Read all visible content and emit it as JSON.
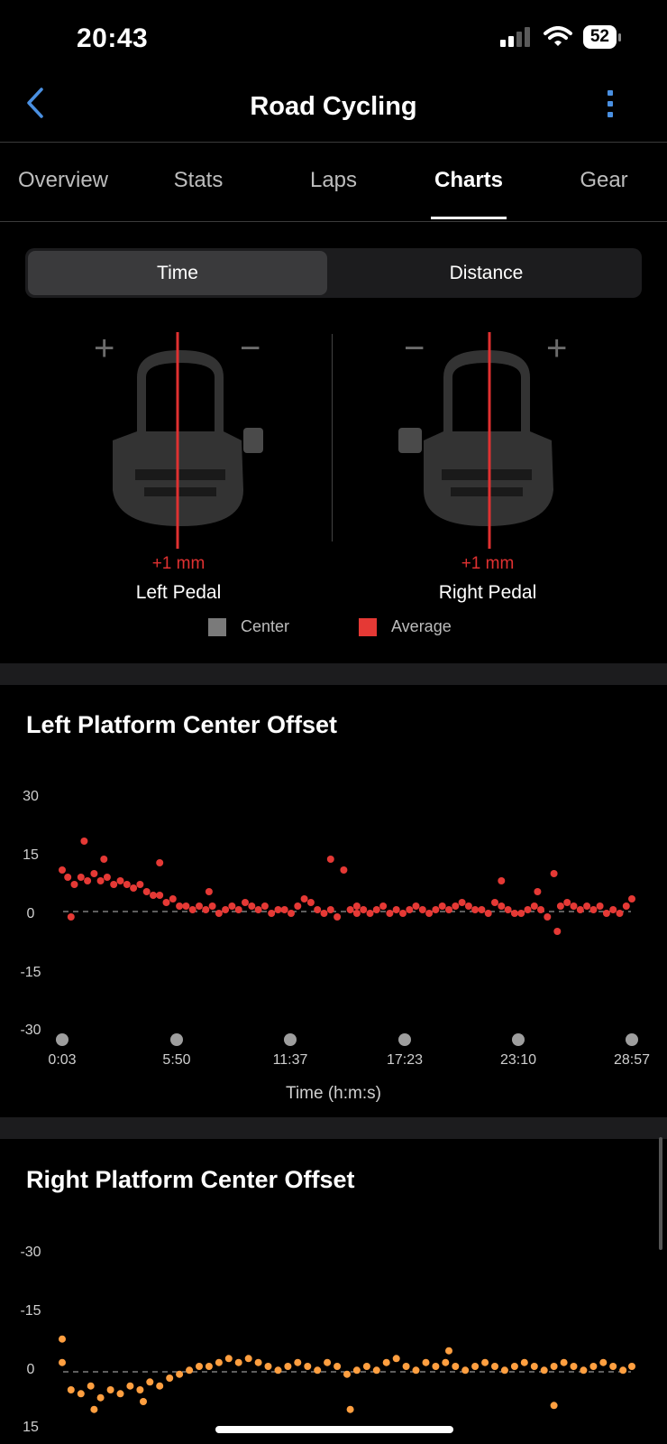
{
  "status": {
    "time": "20:43",
    "battery": "52",
    "icons": [
      "cellular-signal-icon",
      "wifi-icon",
      "battery-icon"
    ]
  },
  "nav": {
    "back_icon": "chevron-left-icon",
    "title": "Road Cycling",
    "more_icon": "vertical-ellipsis-icon"
  },
  "tabs": [
    {
      "label": "Overview",
      "active": false
    },
    {
      "label": "Stats",
      "active": false
    },
    {
      "label": "Laps",
      "active": false
    },
    {
      "label": "Charts",
      "active": true
    },
    {
      "label": "Gear",
      "active": false
    }
  ],
  "segment": {
    "options": [
      "Time",
      "Distance"
    ],
    "selected": "Time"
  },
  "pedals": {
    "left": {
      "offset": "+1 mm",
      "label": "Left Pedal",
      "plus": "+",
      "minus": "−"
    },
    "right": {
      "offset": "+1 mm",
      "label": "Right Pedal",
      "plus": "+",
      "minus": "−"
    }
  },
  "legend": [
    {
      "label": "Center",
      "color": "#7a7a7a"
    },
    {
      "label": "Average",
      "color": "#e53935"
    }
  ],
  "colors": {
    "accent": "#4a90e2",
    "left_series": "#e53935",
    "right_series": "#ff9f40",
    "average_line": "#e03131"
  },
  "chart_data": [
    {
      "type": "scatter",
      "title": "Left Platform Center Offset",
      "xlabel": "Time (h:m:s)",
      "ylabel": "",
      "y_ticks": [
        "30",
        "15",
        "0",
        "-15",
        "-30"
      ],
      "ylim": [
        -30,
        30
      ],
      "x_ticks": [
        "0:03",
        "5:50",
        "11:37",
        "17:23",
        "23:10",
        "28:57"
      ],
      "x_range_seconds": [
        3,
        1737
      ],
      "series": [
        {
          "color": "#e53935",
          "points": [
            [
              3,
              10
            ],
            [
              20,
              8
            ],
            [
              40,
              6
            ],
            [
              60,
              8
            ],
            [
              80,
              7
            ],
            [
              100,
              9
            ],
            [
              120,
              7
            ],
            [
              140,
              8
            ],
            [
              160,
              6
            ],
            [
              180,
              7
            ],
            [
              200,
              6
            ],
            [
              220,
              5
            ],
            [
              240,
              6
            ],
            [
              260,
              4
            ],
            [
              280,
              3
            ],
            [
              300,
              3
            ],
            [
              320,
              1
            ],
            [
              340,
              2
            ],
            [
              360,
              0
            ],
            [
              380,
              0
            ],
            [
              400,
              -1
            ],
            [
              420,
              0
            ],
            [
              440,
              -1
            ],
            [
              460,
              0
            ],
            [
              480,
              -2
            ],
            [
              500,
              -1
            ],
            [
              520,
              0
            ],
            [
              540,
              -1
            ],
            [
              560,
              1
            ],
            [
              580,
              0
            ],
            [
              600,
              -1
            ],
            [
              620,
              0
            ],
            [
              640,
              -2
            ],
            [
              660,
              -1
            ],
            [
              680,
              -1
            ],
            [
              700,
              -2
            ],
            [
              720,
              0
            ],
            [
              740,
              2
            ],
            [
              760,
              1
            ],
            [
              780,
              -1
            ],
            [
              800,
              -2
            ],
            [
              820,
              -1
            ],
            [
              840,
              -3
            ],
            [
              860,
              10
            ],
            [
              880,
              -1
            ],
            [
              900,
              0
            ],
            [
              920,
              -1
            ],
            [
              940,
              -2
            ],
            [
              960,
              -1
            ],
            [
              980,
              0
            ],
            [
              1000,
              -2
            ],
            [
              1020,
              -1
            ],
            [
              1040,
              -2
            ],
            [
              1060,
              -1
            ],
            [
              1080,
              0
            ],
            [
              1100,
              -1
            ],
            [
              1120,
              -2
            ],
            [
              1140,
              -1
            ],
            [
              1160,
              0
            ],
            [
              1180,
              -1
            ],
            [
              1200,
              0
            ],
            [
              1220,
              1
            ],
            [
              1240,
              0
            ],
            [
              1260,
              -1
            ],
            [
              1280,
              -1
            ],
            [
              1300,
              -2
            ],
            [
              1320,
              1
            ],
            [
              1340,
              0
            ],
            [
              1360,
              -1
            ],
            [
              1380,
              -2
            ],
            [
              1400,
              -2
            ],
            [
              1420,
              -1
            ],
            [
              1440,
              0
            ],
            [
              1460,
              -1
            ],
            [
              1480,
              -3
            ],
            [
              1500,
              9
            ],
            [
              1520,
              0
            ],
            [
              1540,
              1
            ],
            [
              1560,
              0
            ],
            [
              1580,
              -1
            ],
            [
              1600,
              0
            ],
            [
              1620,
              -1
            ],
            [
              1640,
              0
            ],
            [
              1660,
              -2
            ],
            [
              1680,
              -1
            ],
            [
              1700,
              -2
            ],
            [
              1720,
              0
            ],
            [
              1737,
              2
            ],
            [
              70,
              18
            ],
            [
              130,
              13
            ],
            [
              300,
              12
            ],
            [
              450,
              4
            ],
            [
              820,
              13
            ],
            [
              900,
              -2
            ],
            [
              1340,
              7
            ],
            [
              1450,
              4
            ],
            [
              1510,
              -7
            ],
            [
              30,
              -3
            ]
          ]
        }
      ]
    },
    {
      "type": "scatter",
      "title": "Right Platform Center Offset",
      "xlabel": "",
      "ylabel": "",
      "y_ticks": [
        "-30",
        "-15",
        "0",
        "15"
      ],
      "ylim": [
        -30,
        15
      ],
      "series": [
        {
          "color": "#ff9f40",
          "points": [
            [
              3,
              -1
            ],
            [
              30,
              6
            ],
            [
              60,
              7
            ],
            [
              90,
              5
            ],
            [
              120,
              8
            ],
            [
              150,
              6
            ],
            [
              180,
              7
            ],
            [
              210,
              5
            ],
            [
              240,
              6
            ],
            [
              270,
              4
            ],
            [
              300,
              5
            ],
            [
              330,
              3
            ],
            [
              360,
              2
            ],
            [
              390,
              1
            ],
            [
              420,
              0
            ],
            [
              450,
              0
            ],
            [
              480,
              -1
            ],
            [
              510,
              -2
            ],
            [
              540,
              -1
            ],
            [
              570,
              -2
            ],
            [
              600,
              -1
            ],
            [
              630,
              0
            ],
            [
              660,
              1
            ],
            [
              690,
              0
            ],
            [
              720,
              -1
            ],
            [
              750,
              0
            ],
            [
              780,
              1
            ],
            [
              810,
              -1
            ],
            [
              840,
              0
            ],
            [
              870,
              2
            ],
            [
              900,
              1
            ],
            [
              930,
              0
            ],
            [
              960,
              1
            ],
            [
              990,
              -1
            ],
            [
              1020,
              -2
            ],
            [
              1050,
              0
            ],
            [
              1080,
              1
            ],
            [
              1110,
              -1
            ],
            [
              1140,
              0
            ],
            [
              1170,
              -1
            ],
            [
              1200,
              0
            ],
            [
              1230,
              1
            ],
            [
              1260,
              0
            ],
            [
              1290,
              -1
            ],
            [
              1320,
              0
            ],
            [
              1350,
              1
            ],
            [
              1380,
              0
            ],
            [
              1410,
              -1
            ],
            [
              1440,
              0
            ],
            [
              1470,
              1
            ],
            [
              1500,
              0
            ],
            [
              1530,
              -1
            ],
            [
              1560,
              0
            ],
            [
              1590,
              1
            ],
            [
              1620,
              0
            ],
            [
              1650,
              -1
            ],
            [
              1680,
              0
            ],
            [
              1710,
              1
            ],
            [
              1737,
              0
            ],
            [
              3,
              -7
            ],
            [
              100,
              11
            ],
            [
              250,
              9
            ],
            [
              880,
              11
            ],
            [
              1500,
              10
            ],
            [
              1180,
              -4
            ]
          ]
        }
      ]
    }
  ]
}
